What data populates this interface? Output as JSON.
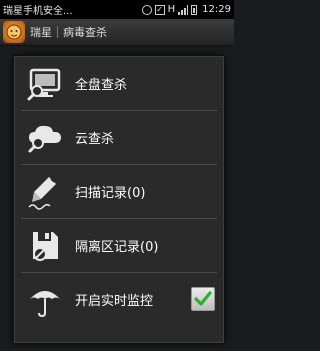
{
  "status_bar": {
    "app_name": "瑞星手机安全...",
    "network_label": "H",
    "time": "12:29"
  },
  "title_bar": {
    "app_name": "瑞星",
    "page_title": "病毒查杀"
  },
  "menu": {
    "items": [
      {
        "label": "全盘查杀",
        "icon": "monitor-search-icon"
      },
      {
        "label": "云查杀",
        "icon": "cloud-search-icon"
      },
      {
        "label": "扫描记录(0)",
        "icon": "pen-icon"
      },
      {
        "label": "隔离区记录(0)",
        "icon": "disk-blocked-icon"
      },
      {
        "label": "开启实时监控",
        "icon": "umbrella-icon",
        "checked": true
      }
    ]
  },
  "colors": {
    "background": "#1a1b1c",
    "panel": "#2a2a2a",
    "check_green": "#2bb32b"
  }
}
